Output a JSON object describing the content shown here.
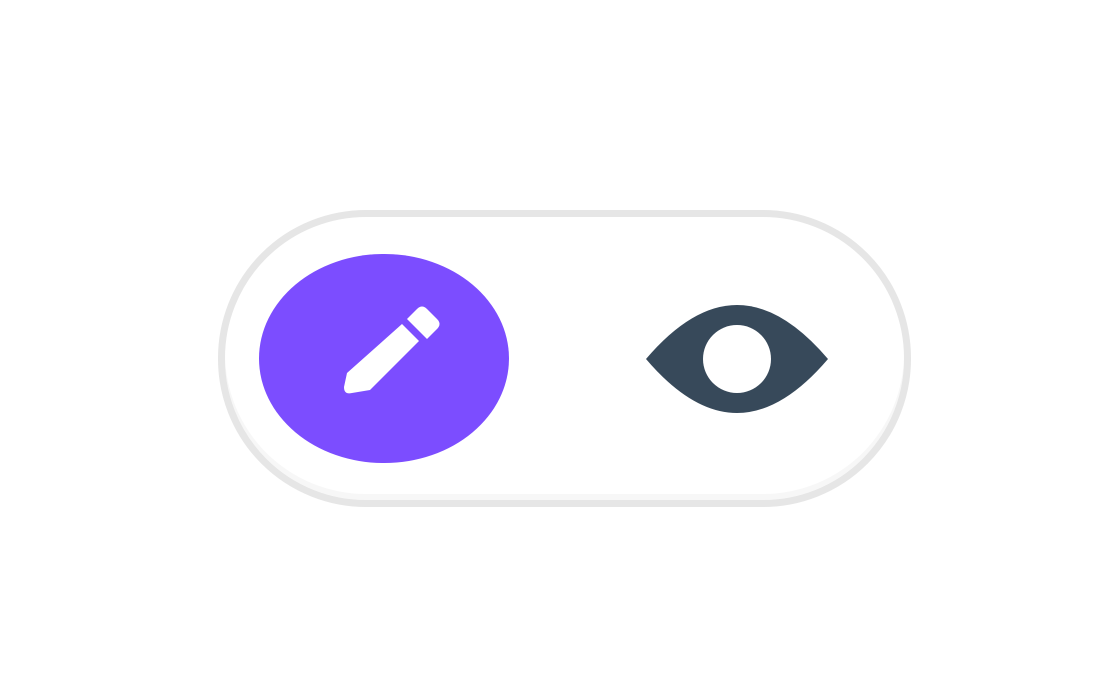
{
  "mode_toggle": {
    "selected": "edit",
    "segments": [
      {
        "id": "edit",
        "icon": "pencil-icon",
        "active": true
      },
      {
        "id": "view",
        "icon": "eye-icon",
        "active": false
      }
    ]
  },
  "colors": {
    "accent": "#7c4dff",
    "icon_active": "#ffffff",
    "icon_inactive": "#37495a",
    "track_border": "#e6e6e6",
    "track_fill": "#ffffff"
  }
}
